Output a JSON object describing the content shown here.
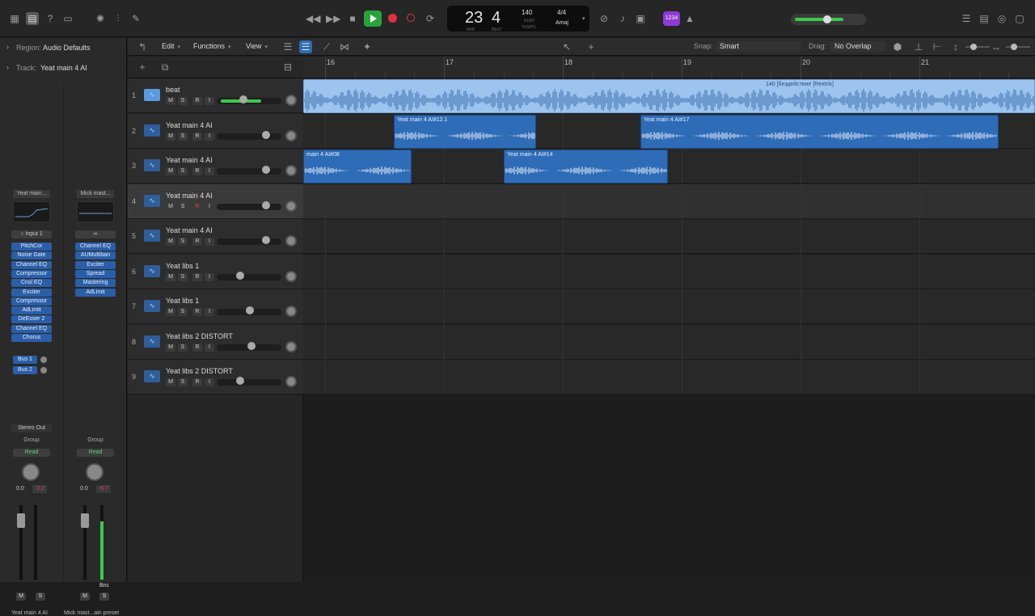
{
  "transport": {
    "bars": "23",
    "beat": "4",
    "bar_label": "BAR",
    "beat_label": "BEAT",
    "tempo": "140",
    "tempo_mode": "KEEP",
    "tempo_label": "TEMPO",
    "signature": "4/4",
    "key": "Amaj",
    "count_in": "1234"
  },
  "inspector": {
    "region_label": "Region:",
    "region_value": "Audio Defaults",
    "track_label": "Track:",
    "track_value": "Yeat main 4 AI"
  },
  "strips": [
    {
      "name": "Yeat main...",
      "input": "Input 1",
      "plugins": [
        "PitchCor",
        "Noise Gate",
        "Channel EQ",
        "Compressor",
        "Cnsl EQ",
        "Exciter",
        "Compressor",
        "AdLimit",
        "DeEsser 2",
        "Channel EQ",
        "Chorus"
      ],
      "sends": [
        "Bus 1",
        "Bus 2"
      ],
      "output": "Stereo Out",
      "group": "Group",
      "automation": "Read",
      "volume": "0.0",
      "peak": "-2.2",
      "mute": "M",
      "solo": "S",
      "bottom_name": "Yeat main 4 AI"
    },
    {
      "name": "Mick mast...",
      "input": "",
      "plugins": [
        "Channel EQ",
        "AUMultiban",
        "Exciter",
        "Spread",
        "Mastering",
        "AdLimit"
      ],
      "sends": [],
      "output": "",
      "group": "Group",
      "automation": "Read",
      "volume": "0.0",
      "peak": "-6.7",
      "mute": "M",
      "solo": "S",
      "bnc": "Bnc",
      "bottom_name": "Mick mast...ain preset"
    }
  ],
  "toolbar": {
    "edit": "Edit",
    "functions": "Functions",
    "view": "View",
    "snap_label": "Snap:",
    "snap_value": "Smart",
    "drag_label": "Drag:",
    "drag_value": "No Overlap"
  },
  "ruler": [
    "16",
    "17",
    "18",
    "19",
    "20",
    "21"
  ],
  "tracks": [
    {
      "num": "1",
      "name": "beat",
      "m": "M",
      "s": "S",
      "r": "R",
      "i": "I",
      "vol": 0.35
    },
    {
      "num": "2",
      "name": "Yeat main 4 AI",
      "m": "M",
      "s": "S",
      "r": "R",
      "i": "I",
      "vol": 0.7
    },
    {
      "num": "3",
      "name": "Yeat main 4 AI",
      "m": "M",
      "s": "S",
      "r": "R",
      "i": "I",
      "vol": 0.7
    },
    {
      "num": "4",
      "name": "Yeat main 4 AI",
      "m": "M",
      "s": "S",
      "r": "R",
      "i": "I",
      "vol": 0.7
    },
    {
      "num": "5",
      "name": "Yeat main 4 AI",
      "m": "M",
      "s": "S",
      "r": "R",
      "i": "I",
      "vol": 0.7
    },
    {
      "num": "6",
      "name": "Yeat libs 1",
      "m": "M",
      "s": "S",
      "r": "R",
      "i": "I",
      "vol": 0.3
    },
    {
      "num": "7",
      "name": "Yeat libs 1",
      "m": "M",
      "s": "S",
      "r": "R",
      "i": "I",
      "vol": 0.45
    },
    {
      "num": "8",
      "name": "Yeat libs 2 DISTORT",
      "m": "M",
      "s": "S",
      "r": "R",
      "i": "I",
      "vol": 0.48
    },
    {
      "num": "9",
      "name": "Yeat libs 2 DISTORT",
      "m": "M",
      "s": "S",
      "r": "R",
      "i": "I",
      "vol": 0.3
    }
  ],
  "regions": [
    {
      "lane": 0,
      "name": "140 [бездействие [Rextrik]",
      "beat": true
    },
    {
      "lane": 1,
      "name": "Yeat main 4 AI#12.1"
    },
    {
      "lane": 1,
      "name": "Yeat main 4 AI#17"
    },
    {
      "lane": 2,
      "name": "main 4 AI#08"
    },
    {
      "lane": 2,
      "name": "Yeat main 4 AI#14"
    }
  ],
  "colors": {
    "region_blue": "#2f6cb8",
    "beat_region": "#9cc4ef",
    "play_green": "#27a33a",
    "record_red": "#e0313f",
    "plugin_blue": "#2b5ea8"
  }
}
